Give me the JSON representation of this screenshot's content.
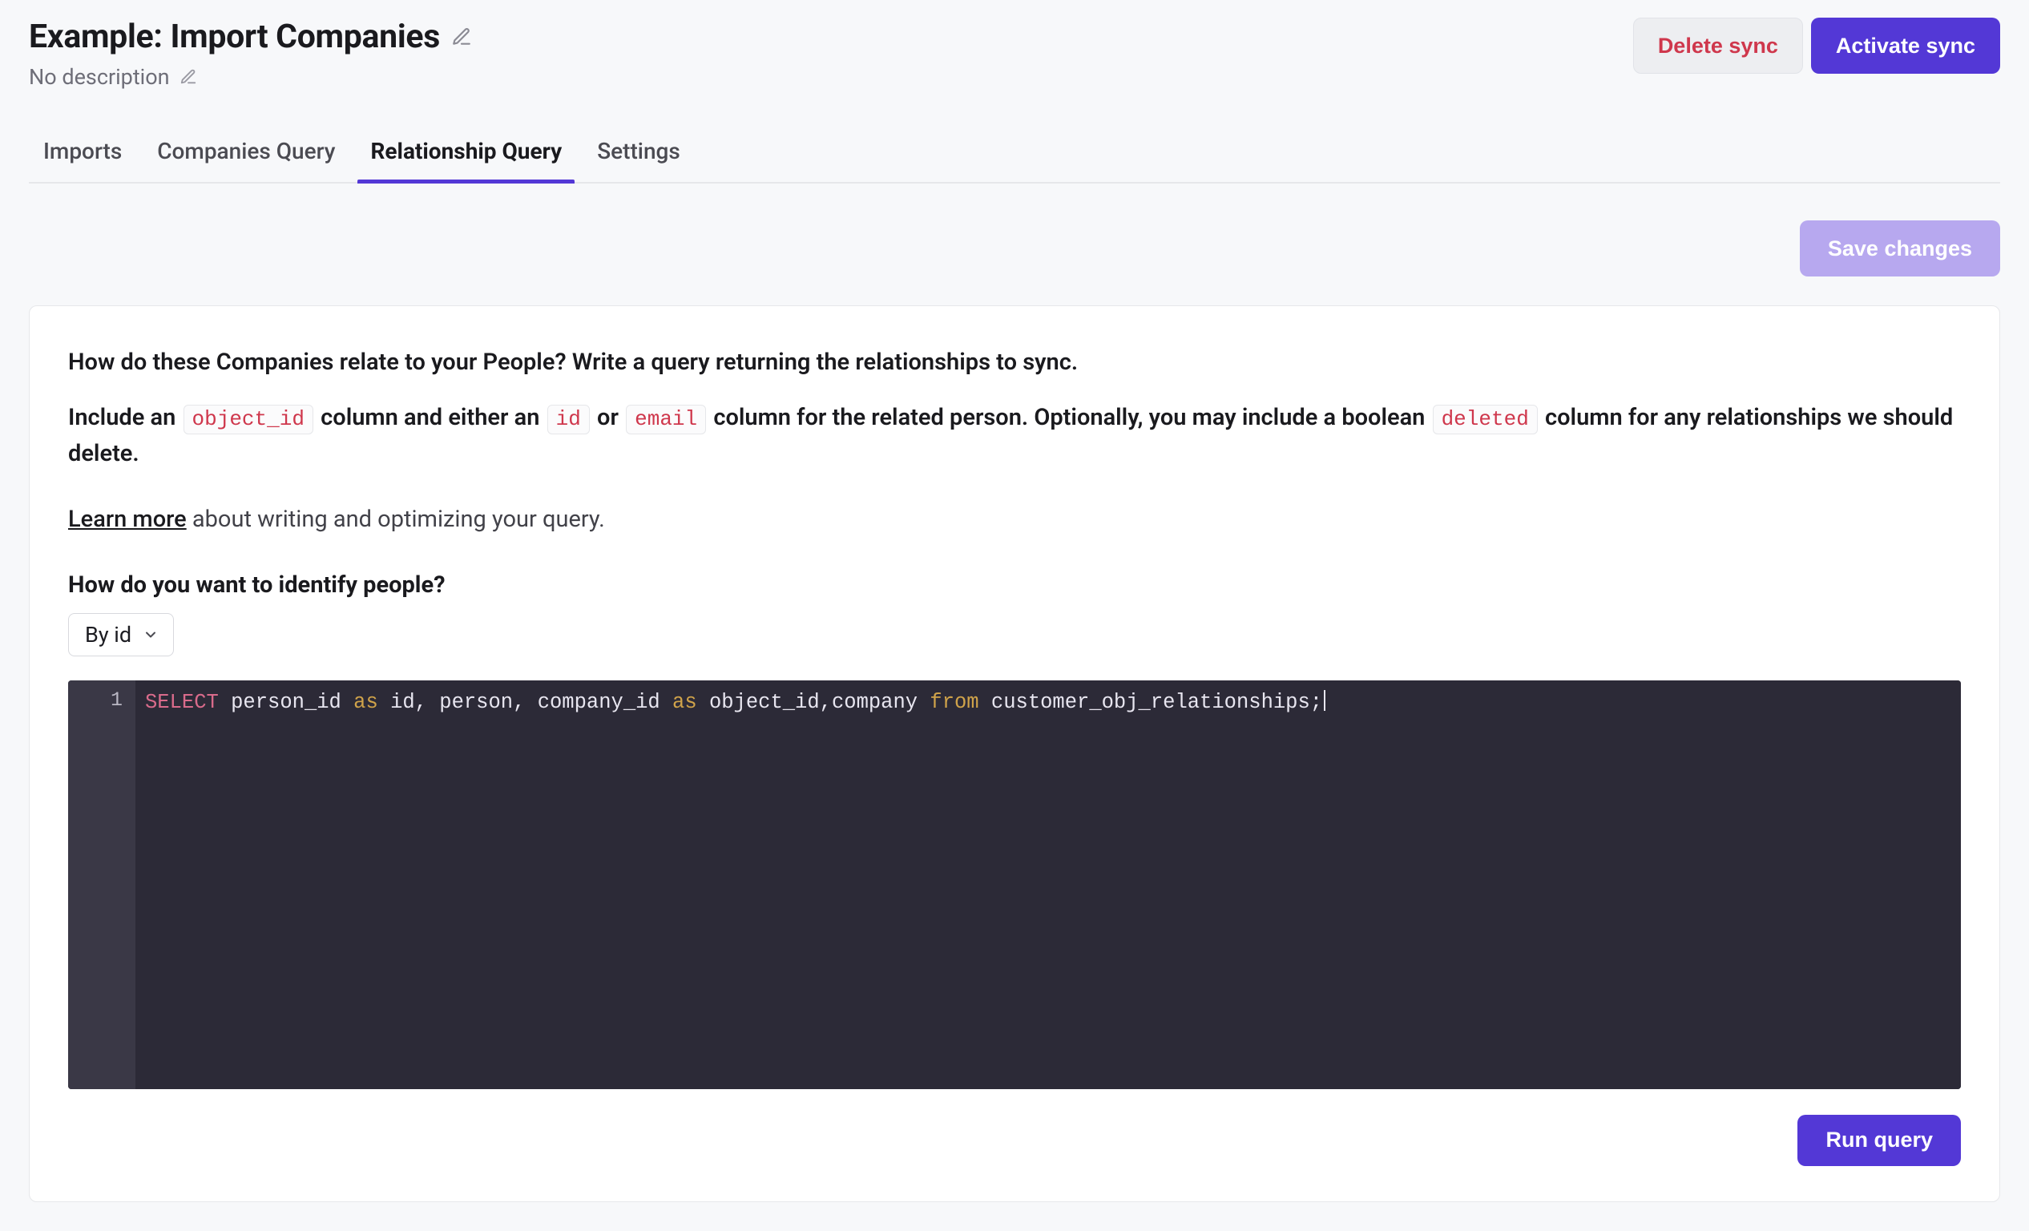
{
  "header": {
    "title": "Example: Import Companies",
    "subtitle": "No description",
    "delete_label": "Delete sync",
    "activate_label": "Activate sync"
  },
  "tabs": [
    {
      "label": "Imports",
      "active": false
    },
    {
      "label": "Companies Query",
      "active": false
    },
    {
      "label": "Relationship Query",
      "active": true
    },
    {
      "label": "Settings",
      "active": false
    }
  ],
  "save_label": "Save changes",
  "instructions": {
    "line1": "How do these Companies relate to your People? Write a query returning the relationships to sync.",
    "line2_pre": "Include an ",
    "code_object_id": "object_id",
    "line2_mid1": " column and either an ",
    "code_id": "id",
    "line2_mid2": " or ",
    "code_email": "email",
    "line2_mid3": " column for the related person. Optionally, you may include a boolean ",
    "code_deleted": "deleted",
    "line2_tail": " column for any relationships we should delete.",
    "learn_link": "Learn more",
    "learn_tail": " about writing and optimizing your query."
  },
  "identify": {
    "question": "How do you want to identify people?",
    "selected": "By id"
  },
  "editor": {
    "line_number": "1",
    "tokens": {
      "select": "SELECT",
      "seg1": " person_id ",
      "as1": "as",
      "seg2": " id, person, company_id ",
      "as2": "as",
      "seg3": " object_id,company ",
      "from": "from",
      "seg4": " customer_obj_relationships;"
    }
  },
  "run_label": "Run query"
}
